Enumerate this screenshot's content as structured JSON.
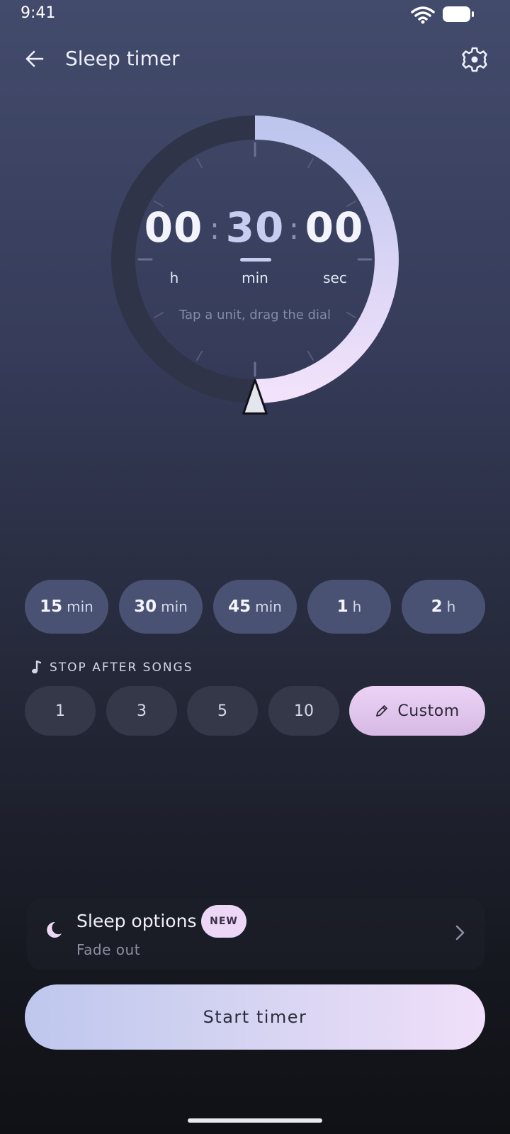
{
  "status": {
    "time": "9:41"
  },
  "appbar": {
    "title": "Sleep timer",
    "back_icon": "arrow-left-icon",
    "settings_icon": "gear-icon"
  },
  "timer": {
    "hours": "00",
    "minutes": "30",
    "seconds": "00",
    "separator": ":",
    "unit_hours": "h",
    "unit_minutes": "min",
    "unit_seconds": "sec",
    "active_unit": "min",
    "hint": "Tap a unit, drag the dial",
    "dial_fraction": 0.5
  },
  "presets": [
    {
      "value": "15",
      "unit": "min"
    },
    {
      "value": "30",
      "unit": "min"
    },
    {
      "value": "45",
      "unit": "min"
    },
    {
      "value": "1",
      "unit": "h"
    },
    {
      "value": "2",
      "unit": "h"
    }
  ],
  "songs": {
    "label": "STOP AFTER SONGS",
    "options": [
      "1",
      "3",
      "5",
      "10"
    ],
    "custom_label": "Custom"
  },
  "sleep_options": {
    "title": "Sleep options",
    "badge": "NEW",
    "subtitle": "Fade out"
  },
  "start_button": {
    "label": "Start timer"
  },
  "colors": {
    "accent": "#c6cdf1",
    "accent_pink": "#ecd7f6",
    "chip": "#4a5274",
    "song_chip": "#353849"
  }
}
